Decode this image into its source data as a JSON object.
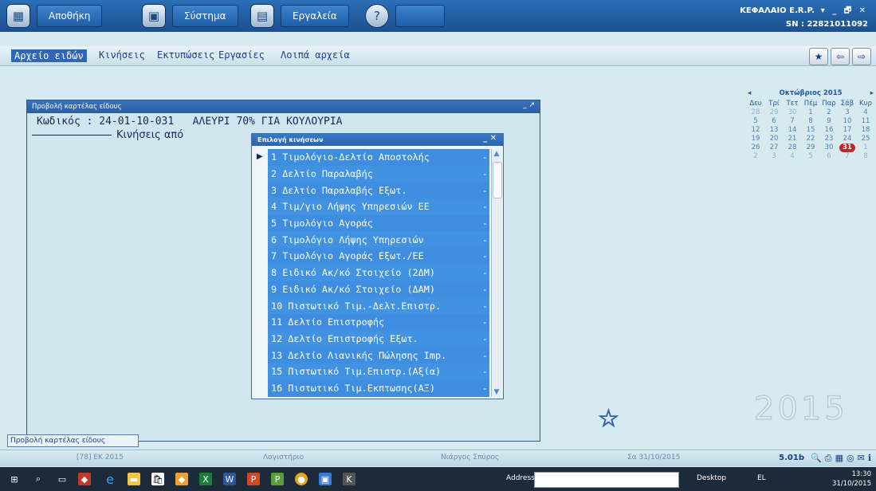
{
  "topbar": {
    "buttons": [
      {
        "label": "Αποθήκη",
        "icon": "warehouse-icon"
      },
      {
        "label": "Σύστημα",
        "icon": "system-icon"
      },
      {
        "label": "Εργαλεία",
        "icon": "tools-icon"
      },
      {
        "label": "",
        "icon": "help-icon"
      }
    ],
    "brand": "ΚΕΦΑΛΑΙΟ E.R.P.",
    "window_controls": "▾  _  🗗  ✕",
    "serial": "SN : 22821011092"
  },
  "menubar": {
    "items": [
      "Αρχείο ειδών",
      "Κινήσεις",
      "Εκτυπώσεις",
      "Εργασίες",
      "Λοιπά αρχεία"
    ]
  },
  "calendar": {
    "month": "Οκτώβριος 2015",
    "weekdays": [
      "Δευ",
      "Τρί",
      "Τετ",
      "Πέμ",
      "Παρ",
      "Σάβ",
      "Κυρ"
    ],
    "weeks": [
      [
        "28",
        "29",
        "30",
        "1",
        "2",
        "3",
        "4"
      ],
      [
        "5",
        "6",
        "7",
        "8",
        "9",
        "10",
        "11"
      ],
      [
        "12",
        "13",
        "14",
        "15",
        "16",
        "17",
        "18"
      ],
      [
        "19",
        "20",
        "21",
        "22",
        "23",
        "24",
        "25"
      ],
      [
        "26",
        "27",
        "28",
        "29",
        "30",
        "31",
        "1"
      ],
      [
        "2",
        "3",
        "4",
        "5",
        "6",
        "7",
        "8"
      ]
    ],
    "today": "31"
  },
  "year_watermark": "2015",
  "window": {
    "title": "Προβολή καρτέλας είδους",
    "controls": "_  ↗",
    "code_label": "Κωδικός : 24-01-10-031",
    "description": "ΑΛΕΥΡΙ 70% ΓΙΑ ΚΟΥΛΟΥΡΙΑ",
    "movements_label": "Κινήσεις από"
  },
  "popup": {
    "title": "Επιλογή κινήσεων",
    "controls": "_  ✕",
    "items": [
      "1 Τιμολόγιο-Δελτίο Αποστολής",
      "2 Δελτίο Παραλαβής",
      "3 Δελτίο Παραλαβής Εξωτ.",
      "4 Τιμ/γιο Λήψης Υπηρεσιών ΕΕ",
      "5 Τιμολόγιο Αγοράς",
      "6 Τιμολόγιο Λήψης Υπηρεσιών",
      "7 Τιμολόγιο Αγοράς Εξωτ./ΕΕ",
      "8 Ειδικό Ακ/κό Στοιχείο (2ΔΜ)",
      "9 Ειδικό Ακ/κό Στοιχείο (ΔΑΜ)",
      "10 Πιστωτικό Τιμ.-Δελτ.Επιστρ.",
      "11 Δελτίο Επιστροφής",
      "12 Δελτίο Επιστροφής Εξωτ.",
      "13 Δελτίο Λιανικής Πώλησης Imp.",
      "15 Πιστωτικό Τιμ.Επιστρ.(Αξία)",
      "16 Πιστωτικό Τιμ.Εκπτωσης(ΑΞ)"
    ]
  },
  "statusbar": {
    "current": "Προβολή καρτέλας είδους",
    "company": "[78] ΕΚ 2015",
    "module": "Λογιστήριο",
    "user": "Νιάργος Σπύρος",
    "date": "Σα 31/10/2015",
    "version": "5.01b"
  },
  "taskbar": {
    "address_label": "Address",
    "desktop_label": "Desktop",
    "language": "EL",
    "time": "13:30",
    "date": "31/10/2015"
  }
}
